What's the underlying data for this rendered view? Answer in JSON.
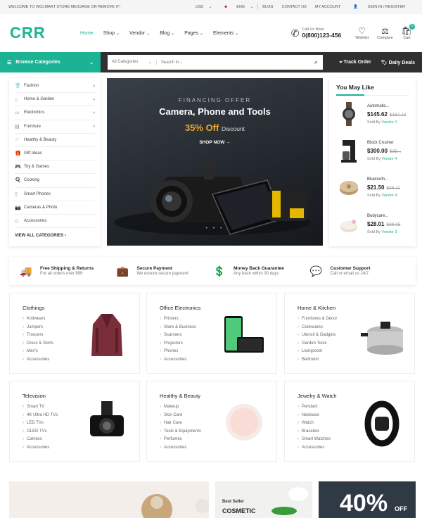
{
  "topbar": {
    "welcome": "WELCOME TO WOLMART STORE MESSAGE OR REMOVE IT!",
    "currency": "USD",
    "language": "ENG",
    "links": [
      "BLOG",
      "CONTACT US",
      "MY ACCOUNT"
    ],
    "signin": "SIGN IN / REGISTER"
  },
  "header": {
    "logo": "CRR",
    "nav": [
      {
        "label": "Home",
        "has_menu": false
      },
      {
        "label": "Shop",
        "has_menu": true
      },
      {
        "label": "Vendor",
        "has_menu": true
      },
      {
        "label": "Blog",
        "has_menu": true
      },
      {
        "label": "Pages",
        "has_menu": true
      },
      {
        "label": "Elements",
        "has_menu": true
      }
    ],
    "call_label": "Call Us Now:",
    "phone": "0(800)123-456",
    "wishlist": "Wishlist",
    "compare": "Compare",
    "cart": "Cart",
    "cart_count": "0"
  },
  "navbar": {
    "browse": "Browse Categories",
    "search_category": "All Categories",
    "search_placeholder": "Search in...",
    "track_order": "Track Order",
    "daily_deals": "Daily Deals"
  },
  "categories": {
    "items": [
      {
        "label": "Fashion",
        "icon": "fashion-icon",
        "has_sub": true
      },
      {
        "label": "Home & Garden",
        "icon": "home-icon",
        "has_sub": true
      },
      {
        "label": "Electronics",
        "icon": "electronics-icon",
        "has_sub": true
      },
      {
        "label": "Furniture",
        "icon": "furniture-icon",
        "has_sub": true
      },
      {
        "label": "Healthy & Beauty",
        "icon": "heart-icon",
        "has_sub": false
      },
      {
        "label": "Gift Ideas",
        "icon": "gift-icon",
        "has_sub": false
      },
      {
        "label": "Toy & Games",
        "icon": "games-icon",
        "has_sub": false
      },
      {
        "label": "Cooking",
        "icon": "cooking-icon",
        "has_sub": false
      },
      {
        "label": "Smart Phones",
        "icon": "phone-icon",
        "has_sub": false
      },
      {
        "label": "Cameras & Photo",
        "icon": "camera-icon",
        "has_sub": false
      },
      {
        "label": "Accessories",
        "icon": "diamond-icon",
        "has_sub": false
      }
    ],
    "view_all": "VIEW ALL CATEGORIES"
  },
  "hero": {
    "kicker": "FINANCING OFFER",
    "title": "Camera, Phone and Tools",
    "discount": "35% Off",
    "discount_word": "Discount",
    "cta": "SHOP NOW"
  },
  "may_like": {
    "title": "You May Like",
    "products": [
      {
        "name": "Automatic...",
        "price": "$145.62",
        "old_price": "$152.13",
        "sold_by": "Sold By",
        "vendor": "Vendor 2"
      },
      {
        "name": "Block Crusher",
        "price": "$300.00",
        "old_price": "$35...",
        "sold_by": "Sold By",
        "vendor": "Vendor 4"
      },
      {
        "name": "Bluetooth...",
        "price": "$21.50",
        "old_price": "$26.11",
        "sold_by": "Sold By",
        "vendor": "Vendor 4"
      },
      {
        "name": "Bodycare...",
        "price": "$28.01",
        "old_price": "$29.25",
        "sold_by": "Sold By",
        "vendor": "Vendor 3"
      }
    ]
  },
  "features": [
    {
      "title": "Free Shipping & Returns",
      "sub": "For all orders over $99",
      "icon": "truck-icon"
    },
    {
      "title": "Secure Payment",
      "sub": "We ensure secure payment",
      "icon": "bag-icon"
    },
    {
      "title": "Money Back Guarantee",
      "sub": "Any back within 30 days",
      "icon": "money-icon"
    },
    {
      "title": "Customer Support",
      "sub": "Call or email us 24/7",
      "icon": "chat-icon"
    }
  ],
  "category_cards": [
    {
      "title": "Clothings",
      "links": [
        "Knitwears",
        "Jumpers",
        "Trousers",
        "Dress & Skirts",
        "Men's",
        "Accessories"
      ]
    },
    {
      "title": "Office Electronics",
      "links": [
        "Printers",
        "Store & Business",
        "Scanners",
        "Projectors",
        "Phones",
        "Accessories"
      ]
    },
    {
      "title": "Home & Kitchen",
      "links": [
        "Furnitures & Decor",
        "Cookwares",
        "Utensil & Gadgets",
        "Garden Tools",
        "Livingroom",
        "Bedroom"
      ]
    },
    {
      "title": "Television",
      "links": [
        "Smart TV",
        "4K Ultra HD TVs",
        "LED TVs",
        "OLED TVs",
        "Camera",
        "Accessories"
      ]
    },
    {
      "title": "Healthy & Beauty",
      "links": [
        "Makeup",
        "Skin Care",
        "Hair Care",
        "Tools & Equipments",
        "Perfumes",
        "Accessories"
      ]
    },
    {
      "title": "Jewelry & Watch",
      "links": [
        "Pendant",
        "Necklace",
        "Watch",
        "Bracelets",
        "Smart Watches",
        "Accessories"
      ]
    }
  ],
  "banners": {
    "best_seller": "Best Seller",
    "cosmetic": "COSMETIC",
    "percent": "40%",
    "off": "OFF"
  },
  "colors": {
    "accent": "#1bb394",
    "dark": "#303030",
    "orange": "#f5a623"
  }
}
